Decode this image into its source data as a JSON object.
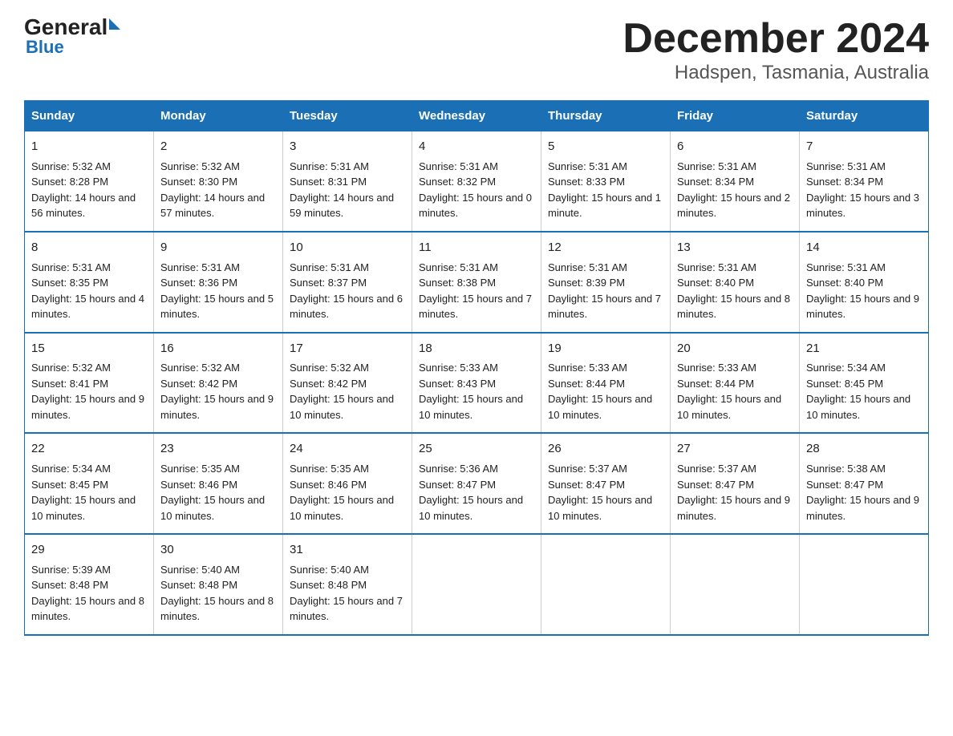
{
  "header": {
    "logo": {
      "general": "General",
      "blue": "Blue"
    },
    "title": "December 2024",
    "subtitle": "Hadspen, Tasmania, Australia"
  },
  "days_of_week": [
    "Sunday",
    "Monday",
    "Tuesday",
    "Wednesday",
    "Thursday",
    "Friday",
    "Saturday"
  ],
  "weeks": [
    [
      {
        "day": "1",
        "sunrise": "5:32 AM",
        "sunset": "8:28 PM",
        "daylight": "14 hours and 56 minutes."
      },
      {
        "day": "2",
        "sunrise": "5:32 AM",
        "sunset": "8:30 PM",
        "daylight": "14 hours and 57 minutes."
      },
      {
        "day": "3",
        "sunrise": "5:31 AM",
        "sunset": "8:31 PM",
        "daylight": "14 hours and 59 minutes."
      },
      {
        "day": "4",
        "sunrise": "5:31 AM",
        "sunset": "8:32 PM",
        "daylight": "15 hours and 0 minutes."
      },
      {
        "day": "5",
        "sunrise": "5:31 AM",
        "sunset": "8:33 PM",
        "daylight": "15 hours and 1 minute."
      },
      {
        "day": "6",
        "sunrise": "5:31 AM",
        "sunset": "8:34 PM",
        "daylight": "15 hours and 2 minutes."
      },
      {
        "day": "7",
        "sunrise": "5:31 AM",
        "sunset": "8:34 PM",
        "daylight": "15 hours and 3 minutes."
      }
    ],
    [
      {
        "day": "8",
        "sunrise": "5:31 AM",
        "sunset": "8:35 PM",
        "daylight": "15 hours and 4 minutes."
      },
      {
        "day": "9",
        "sunrise": "5:31 AM",
        "sunset": "8:36 PM",
        "daylight": "15 hours and 5 minutes."
      },
      {
        "day": "10",
        "sunrise": "5:31 AM",
        "sunset": "8:37 PM",
        "daylight": "15 hours and 6 minutes."
      },
      {
        "day": "11",
        "sunrise": "5:31 AM",
        "sunset": "8:38 PM",
        "daylight": "15 hours and 7 minutes."
      },
      {
        "day": "12",
        "sunrise": "5:31 AM",
        "sunset": "8:39 PM",
        "daylight": "15 hours and 7 minutes."
      },
      {
        "day": "13",
        "sunrise": "5:31 AM",
        "sunset": "8:40 PM",
        "daylight": "15 hours and 8 minutes."
      },
      {
        "day": "14",
        "sunrise": "5:31 AM",
        "sunset": "8:40 PM",
        "daylight": "15 hours and 9 minutes."
      }
    ],
    [
      {
        "day": "15",
        "sunrise": "5:32 AM",
        "sunset": "8:41 PM",
        "daylight": "15 hours and 9 minutes."
      },
      {
        "day": "16",
        "sunrise": "5:32 AM",
        "sunset": "8:42 PM",
        "daylight": "15 hours and 9 minutes."
      },
      {
        "day": "17",
        "sunrise": "5:32 AM",
        "sunset": "8:42 PM",
        "daylight": "15 hours and 10 minutes."
      },
      {
        "day": "18",
        "sunrise": "5:33 AM",
        "sunset": "8:43 PM",
        "daylight": "15 hours and 10 minutes."
      },
      {
        "day": "19",
        "sunrise": "5:33 AM",
        "sunset": "8:44 PM",
        "daylight": "15 hours and 10 minutes."
      },
      {
        "day": "20",
        "sunrise": "5:33 AM",
        "sunset": "8:44 PM",
        "daylight": "15 hours and 10 minutes."
      },
      {
        "day": "21",
        "sunrise": "5:34 AM",
        "sunset": "8:45 PM",
        "daylight": "15 hours and 10 minutes."
      }
    ],
    [
      {
        "day": "22",
        "sunrise": "5:34 AM",
        "sunset": "8:45 PM",
        "daylight": "15 hours and 10 minutes."
      },
      {
        "day": "23",
        "sunrise": "5:35 AM",
        "sunset": "8:46 PM",
        "daylight": "15 hours and 10 minutes."
      },
      {
        "day": "24",
        "sunrise": "5:35 AM",
        "sunset": "8:46 PM",
        "daylight": "15 hours and 10 minutes."
      },
      {
        "day": "25",
        "sunrise": "5:36 AM",
        "sunset": "8:47 PM",
        "daylight": "15 hours and 10 minutes."
      },
      {
        "day": "26",
        "sunrise": "5:37 AM",
        "sunset": "8:47 PM",
        "daylight": "15 hours and 10 minutes."
      },
      {
        "day": "27",
        "sunrise": "5:37 AM",
        "sunset": "8:47 PM",
        "daylight": "15 hours and 9 minutes."
      },
      {
        "day": "28",
        "sunrise": "5:38 AM",
        "sunset": "8:47 PM",
        "daylight": "15 hours and 9 minutes."
      }
    ],
    [
      {
        "day": "29",
        "sunrise": "5:39 AM",
        "sunset": "8:48 PM",
        "daylight": "15 hours and 8 minutes."
      },
      {
        "day": "30",
        "sunrise": "5:40 AM",
        "sunset": "8:48 PM",
        "daylight": "15 hours and 8 minutes."
      },
      {
        "day": "31",
        "sunrise": "5:40 AM",
        "sunset": "8:48 PM",
        "daylight": "15 hours and 7 minutes."
      },
      null,
      null,
      null,
      null
    ]
  ]
}
